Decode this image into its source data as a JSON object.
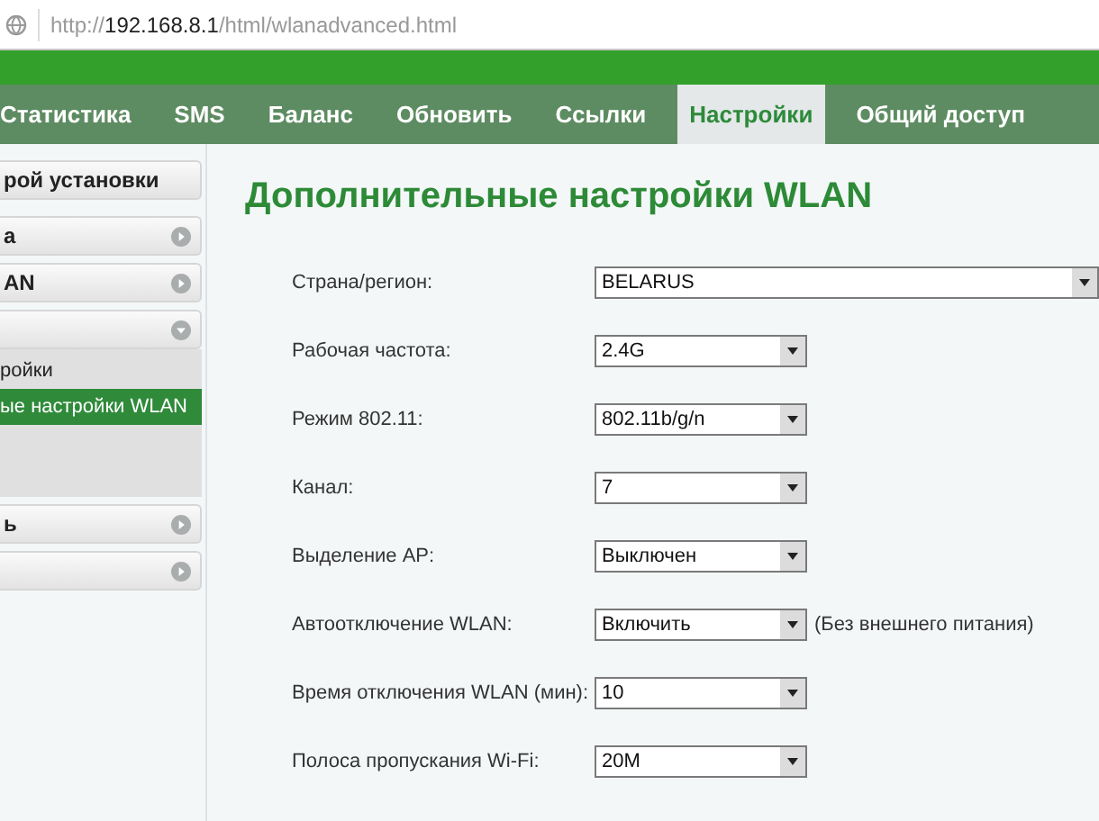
{
  "address_bar": {
    "scheme": "http://",
    "host": "192.168.8.1",
    "path": "/html/wlanadvanced.html"
  },
  "nav": [
    {
      "label": "Статистика",
      "selected": false
    },
    {
      "label": "SMS",
      "selected": false
    },
    {
      "label": "Баланс",
      "selected": false
    },
    {
      "label": "Обновить",
      "selected": false
    },
    {
      "label": "Ссылки",
      "selected": false
    },
    {
      "label": "Настройки",
      "selected": true
    },
    {
      "label": "Общий доступ",
      "selected": false
    }
  ],
  "sidebar": {
    "items": [
      {
        "label": "рой установки",
        "kind": "plain"
      },
      {
        "label": "а",
        "kind": "collapsed"
      },
      {
        "label": "AN",
        "kind": "collapsed"
      },
      {
        "kind": "expanded",
        "children": [
          {
            "label": "ройки",
            "selected": false
          },
          {
            "label": "ые настройки WLAN",
            "selected": true
          }
        ]
      },
      {
        "label": "ь",
        "kind": "collapsed"
      },
      {
        "kind": "collapsed"
      }
    ]
  },
  "page_title": "Дополнительные настройки WLAN",
  "fields": [
    {
      "label": "Страна/регион:",
      "value": "BELARUS",
      "kind": "wide"
    },
    {
      "label": "Рабочая частота:",
      "value": "2.4G",
      "kind": "normal"
    },
    {
      "label": "Режим 802.11:",
      "value": "802.11b/g/n",
      "kind": "normal"
    },
    {
      "label": "Канал:",
      "value": "7",
      "kind": "normal"
    },
    {
      "label": "Выделение AP:",
      "value": "Выключен",
      "kind": "normal"
    },
    {
      "label": "Автоотключение WLAN:",
      "value": "Включить",
      "kind": "normal",
      "note": "(Без внешнего питания)"
    },
    {
      "label": "Время отключения WLAN (мин):",
      "value": "10",
      "kind": "normal"
    },
    {
      "label": "Полоса пропускания Wi-Fi:",
      "value": "20M",
      "kind": "normal"
    }
  ]
}
